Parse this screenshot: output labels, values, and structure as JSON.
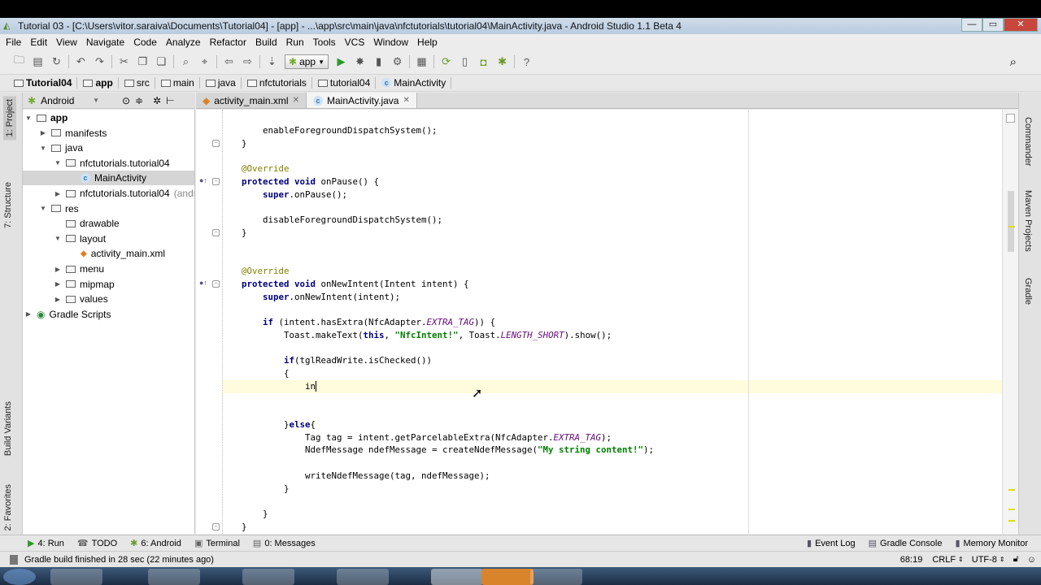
{
  "window": {
    "title": "Tutorial 03 - [C:\\Users\\vitor.saraiva\\Documents\\Tutorial04] - [app] - ...\\app\\src\\main\\java\\nfctutorials\\tutorial04\\MainActivity.java - Android Studio 1.1 Beta 4"
  },
  "menu": [
    "File",
    "Edit",
    "View",
    "Navigate",
    "Code",
    "Analyze",
    "Refactor",
    "Build",
    "Run",
    "Tools",
    "VCS",
    "Window",
    "Help"
  ],
  "toolbar": {
    "run_config": "app",
    "icons": [
      "open-icon",
      "save-icon",
      "sync-icon",
      "undo-icon",
      "redo-icon",
      "cut-icon",
      "copy-icon",
      "paste-icon",
      "find-icon",
      "replace-icon",
      "back-icon",
      "forward-icon",
      "make-icon",
      "run-icon",
      "debug-icon",
      "attach-debugger-icon",
      "project-structure-icon",
      "sdk-manager-icon",
      "gradle-sync-icon",
      "avd-manager-icon",
      "android-monitor-icon",
      "android-device-icon",
      "help-icon"
    ]
  },
  "breadcrumbs": [
    "Tutorial04",
    "app",
    "src",
    "main",
    "java",
    "nfctutorials",
    "tutorial04",
    "MainActivity"
  ],
  "project_panel": {
    "view": "Android",
    "tree": [
      {
        "label": "app",
        "depth": 0,
        "expanded": true,
        "bold": true
      },
      {
        "label": "manifests",
        "depth": 1,
        "expanded": false
      },
      {
        "label": "java",
        "depth": 1,
        "expanded": true
      },
      {
        "label": "nfctutorials.tutorial04",
        "depth": 2,
        "expanded": true
      },
      {
        "label": "MainActivity",
        "depth": 3,
        "selected": true
      },
      {
        "label": "nfctutorials.tutorial04",
        "suffix": "(andro",
        "depth": 2,
        "expanded": false
      },
      {
        "label": "res",
        "depth": 1,
        "expanded": true
      },
      {
        "label": "drawable",
        "depth": 2
      },
      {
        "label": "layout",
        "depth": 2,
        "expanded": true
      },
      {
        "label": "activity_main.xml",
        "depth": 3
      },
      {
        "label": "menu",
        "depth": 2,
        "expanded": false
      },
      {
        "label": "mipmap",
        "depth": 2,
        "expanded": false
      },
      {
        "label": "values",
        "depth": 2,
        "expanded": false
      },
      {
        "label": "Gradle Scripts",
        "depth": 0,
        "expanded": false
      }
    ]
  },
  "left_tool_tabs": [
    "1: Project",
    "7: Structure",
    "Build Variants",
    "2: Favorites"
  ],
  "right_tool_tabs": [
    "Commander",
    "Maven Projects",
    "Gradle"
  ],
  "editor": {
    "tabs": [
      {
        "label": "activity_main.xml",
        "active": false
      },
      {
        "label": "MainActivity.java",
        "active": true
      }
    ],
    "caret_line_index": 20,
    "lines": [
      [
        [
          "    enableForegroundDispatchSystem();",
          ""
        ]
      ],
      [
        [
          "}",
          ""
        ]
      ],
      [],
      [
        [
          "@Override",
          "a"
        ]
      ],
      [
        [
          "protected void ",
          "k"
        ],
        [
          "onPause() {",
          ""
        ]
      ],
      [
        [
          "    super",
          "k"
        ],
        [
          ".onPause();",
          ""
        ]
      ],
      [],
      [
        [
          "    disableForegroundDispatchSystem();",
          ""
        ]
      ],
      [
        [
          "}",
          ""
        ]
      ],
      [],
      [],
      [
        [
          "@Override",
          "a"
        ]
      ],
      [
        [
          "protected void ",
          "k"
        ],
        [
          "onNewIntent(Intent intent) {",
          ""
        ]
      ],
      [
        [
          "    super",
          "k"
        ],
        [
          ".onNewIntent(intent);",
          ""
        ]
      ],
      [],
      [
        [
          "    if ",
          "k"
        ],
        [
          "(intent.hasExtra(NfcAdapter.",
          ""
        ],
        [
          "EXTRA_TAG",
          "c"
        ],
        [
          ")) {",
          ""
        ]
      ],
      [
        [
          "        Toast.makeText(",
          ""
        ],
        [
          "this",
          "k"
        ],
        [
          ", ",
          ""
        ],
        [
          "\"NfcIntent!\"",
          "s"
        ],
        [
          ", Toast.",
          ""
        ],
        [
          "LENGTH_SHORT",
          "c"
        ],
        [
          ").show();",
          ""
        ]
      ],
      [],
      [
        [
          "        if",
          "k"
        ],
        [
          "(tglReadWrite.isChecked())",
          ""
        ]
      ],
      [
        [
          "        {",
          ""
        ]
      ],
      [
        [
          "            in",
          ""
        ]
      ],
      [],
      [],
      [
        [
          "        }",
          ""
        ],
        [
          "else",
          "k"
        ],
        [
          "{",
          ""
        ]
      ],
      [
        [
          "            Tag tag = intent.getParcelableExtra(NfcAdapter.",
          ""
        ],
        [
          "EXTRA_TAG",
          "c"
        ],
        [
          ");",
          ""
        ]
      ],
      [
        [
          "            NdefMessage ndefMessage = createNdefMessage(",
          ""
        ],
        [
          "\"My string content!\"",
          "s"
        ],
        [
          ");",
          ""
        ]
      ],
      [],
      [
        [
          "            writeNdefMessage(tag, ndefMessage);",
          ""
        ]
      ],
      [
        [
          "        }",
          ""
        ]
      ],
      [],
      [
        [
          "    }",
          ""
        ]
      ],
      [
        [
          "}",
          ""
        ]
      ]
    ]
  },
  "tool_windows": {
    "left": [
      {
        "label": "4: Run",
        "icon": "run-icon"
      },
      {
        "label": "TODO",
        "icon": "todo-icon"
      },
      {
        "label": "6: Android",
        "icon": "android-icon"
      },
      {
        "label": "Terminal",
        "icon": "terminal-icon"
      },
      {
        "label": "0: Messages",
        "icon": "messages-icon"
      }
    ],
    "right": [
      {
        "label": "Event Log",
        "icon": "event-log-icon"
      },
      {
        "label": "Gradle Console",
        "icon": "gradle-console-icon"
      },
      {
        "label": "Memory Monitor",
        "icon": "memory-monitor-icon"
      }
    ]
  },
  "status": {
    "message": "Gradle build finished in 28 sec (22 minutes ago)",
    "position": "68:19",
    "line_separator": "CRLF",
    "encoding": "UTF-8"
  },
  "colors": {
    "keyword": "#000080",
    "annotation": "#808000",
    "string": "#008000",
    "constant": "#660e7a",
    "caret_line": "#fffbdc"
  }
}
